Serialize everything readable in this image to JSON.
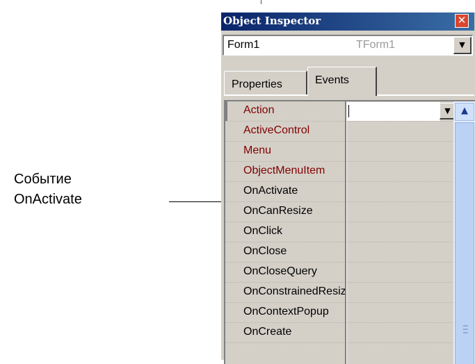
{
  "annotation": {
    "line1": "Событие",
    "line2": "OnActivate"
  },
  "inspector": {
    "title": "Object Inspector",
    "close_glyph": "✕",
    "object_combo": {
      "name": "Form1",
      "type": "TForm1",
      "button_glyph": "▼"
    },
    "tabs": [
      {
        "label": "Properties",
        "active": false
      },
      {
        "label": "Events",
        "active": true
      }
    ],
    "rows": [
      {
        "name": "Action",
        "required": true,
        "selected": true
      },
      {
        "name": "ActiveControl",
        "required": true
      },
      {
        "name": "Menu",
        "required": true
      },
      {
        "name": "ObjectMenuItem",
        "required": true
      },
      {
        "name": "OnActivate",
        "required": false
      },
      {
        "name": "OnCanResize",
        "required": false
      },
      {
        "name": "OnClick",
        "required": false
      },
      {
        "name": "OnClose",
        "required": false
      },
      {
        "name": "OnCloseQuery",
        "required": false
      },
      {
        "name": "OnConstrainedResize",
        "required": false
      },
      {
        "name": "OnContextPopup",
        "required": false
      },
      {
        "name": "OnCreate",
        "required": false
      }
    ],
    "value_button_glyph": "▼",
    "scroll_up_glyph": "▲",
    "colors": {
      "title_start": "#0a246a",
      "title_end": "#3a6ea5",
      "reference_property": "#800000",
      "event_property": "#000000",
      "scrollbar": "#bcd2f4"
    }
  }
}
